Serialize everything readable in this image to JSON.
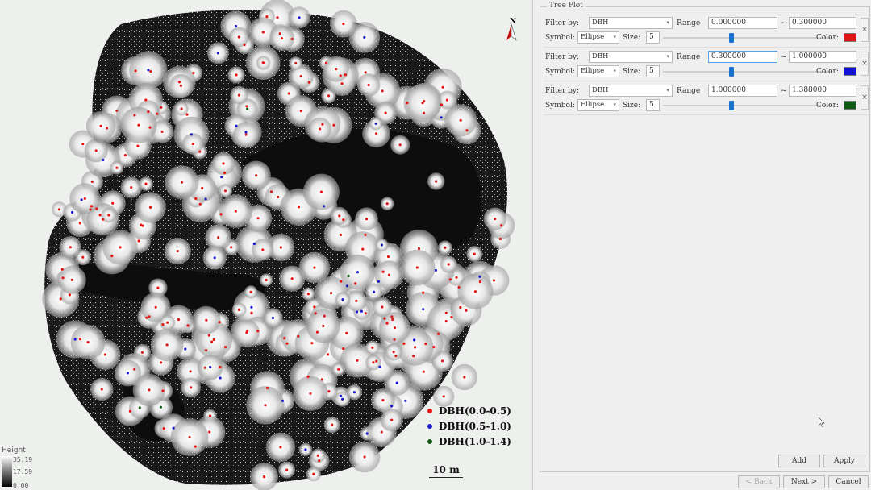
{
  "map": {
    "north_label": "N",
    "legend": [
      {
        "label": "DBH(0.0-0.5)",
        "color": "#e01818"
      },
      {
        "label": "DBH(0.5-1.0)",
        "color": "#1a1acc"
      },
      {
        "label": "DBH(1.0-1.4)",
        "color": "#0e5a12"
      }
    ],
    "scalebar_label": "10 m",
    "height_legend": {
      "title": "Height",
      "max": "35.19",
      "mid": "17.59",
      "min": "0.00"
    }
  },
  "panel": {
    "group_title": "Tree Plot",
    "filters": [
      {
        "filter_by_label": "Filter by:",
        "filter_by": "DBH",
        "range_label": "Range",
        "range_min": "0.000000",
        "tilde": "~",
        "range_max": "0.300000",
        "symbol_label": "Symbol:",
        "symbol": "Ellipse",
        "size_label": "Size:",
        "size": "5",
        "color_label": "Color:",
        "color": "#e11414",
        "slider": 0.5
      },
      {
        "filter_by_label": "Filter by:",
        "filter_by": "DBH",
        "range_label": "Range",
        "range_min": "0.300000",
        "tilde": "~",
        "range_max": "1.000000",
        "symbol_label": "Symbol:",
        "symbol": "Ellipse",
        "size_label": "Size:",
        "size": "5",
        "color_label": "Color:",
        "color": "#1212d8",
        "slider": 0.5
      },
      {
        "filter_by_label": "Filter by:",
        "filter_by": "DBH",
        "range_label": "Range",
        "range_min": "1.000000",
        "tilde": "~",
        "range_max": "1.388000",
        "symbol_label": "Symbol:",
        "symbol": "Ellipse",
        "size_label": "Size:",
        "size": "5",
        "color_label": "Color:",
        "color": "#0f5a12",
        "slider": 0.5
      }
    ],
    "add_label": "Add",
    "apply_label": "Apply",
    "back_label": "< Back",
    "next_label": "Next >",
    "cancel_label": "Cancel",
    "close_glyph": "×"
  }
}
